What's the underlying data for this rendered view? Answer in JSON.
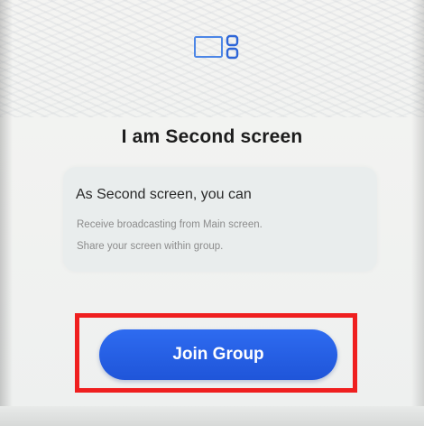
{
  "header": {
    "icon": "second-screen-icon",
    "title": "I am Second screen"
  },
  "info": {
    "heading": "As Second screen, you can",
    "lines": [
      "Receive broadcasting from Main screen.",
      "Share your screen within group."
    ]
  },
  "actions": {
    "join_label": "Join Group"
  },
  "colors": {
    "accent": "#1f55d9",
    "highlight": "#ef1f1f"
  }
}
